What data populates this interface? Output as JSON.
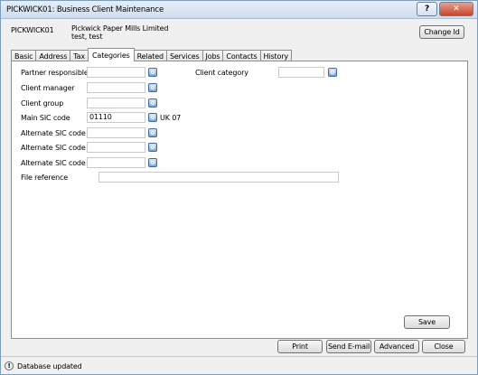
{
  "window": {
    "title": "PICKWICK01: Business Client Maintenance",
    "help_glyph": "?",
    "close_glyph": "✕"
  },
  "header": {
    "client_id": "PICKWICK01",
    "client_name": "Pickwick Paper Mills Limited",
    "client_subtitle": "test, test",
    "change_id_label": "Change Id"
  },
  "tabs": [
    "Basic",
    "Address",
    "Tax",
    "Categories",
    "Related",
    "Services",
    "Jobs",
    "Contacts",
    "History"
  ],
  "active_tab": "Categories",
  "form": {
    "partner_responsible": {
      "label": "Partner responsible",
      "value": ""
    },
    "client_manager": {
      "label": "Client manager",
      "value": ""
    },
    "client_group": {
      "label": "Client group",
      "value": ""
    },
    "main_sic": {
      "label": "Main SIC code",
      "value": "01110",
      "suffix": "UK 07"
    },
    "alt_sic_1": {
      "label": "Alternate SIC code",
      "value": ""
    },
    "alt_sic_2": {
      "label": "Alternate SIC code",
      "value": ""
    },
    "alt_sic_3": {
      "label": "Alternate SIC code",
      "value": ""
    },
    "file_reference": {
      "label": "File reference",
      "value": ""
    },
    "client_category": {
      "label": "Client category",
      "value": ""
    }
  },
  "buttons": {
    "save": "Save",
    "print": "Print",
    "send_email": "Send E-mail",
    "advanced": "Advanced",
    "close": "Close"
  },
  "status": {
    "icon_glyph": "!",
    "text": "Database updated"
  }
}
